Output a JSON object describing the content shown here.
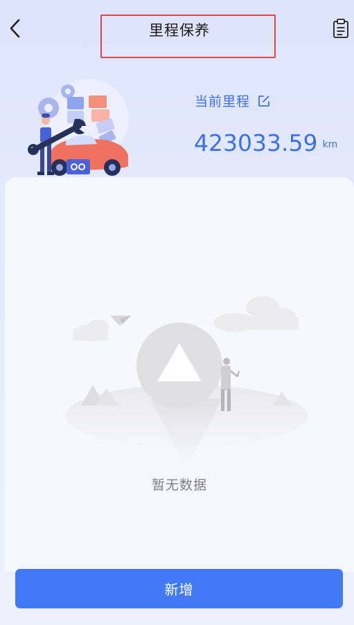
{
  "header": {
    "title": "里程保养",
    "back_icon": "chevron-left-icon",
    "record_icon": "clipboard-list-icon"
  },
  "mileage": {
    "label": "当前里程",
    "edit_icon": "edit-icon",
    "value": "423033.59",
    "unit": "km"
  },
  "empty_state": {
    "text": "暂无数据"
  },
  "actions": {
    "add_label": "新增"
  },
  "colors": {
    "accent": "#3d70e8",
    "button": "#4279f7",
    "highlight_frame": "#e0454a",
    "page_bg": "#e3e8fb",
    "card_bg": "#f7f8fe"
  }
}
